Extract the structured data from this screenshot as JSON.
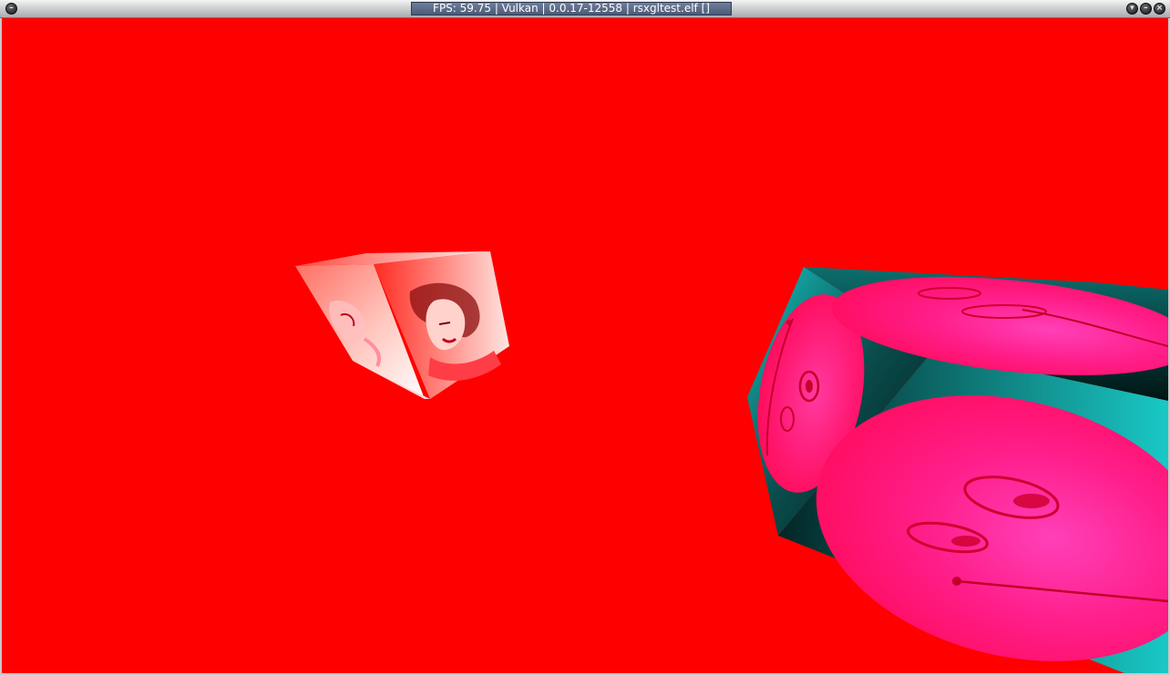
{
  "window": {
    "title": "FPS: 59.75 | Vulkan | 0.0.17-12558 | rsxgltest.elf []",
    "menu_icon": "minus-circle-icon",
    "shade_icon": "chevron-down-circle-icon",
    "iconify_icon": "minus-circle-icon",
    "close_icon": "x-circle-icon"
  },
  "viewport": {
    "background_color": "#ff0000",
    "objects": [
      {
        "name": "small-textured-cube",
        "texture": "portrait"
      },
      {
        "name": "large-textured-cube",
        "texture": "pink-ellipse-pattern"
      }
    ]
  }
}
